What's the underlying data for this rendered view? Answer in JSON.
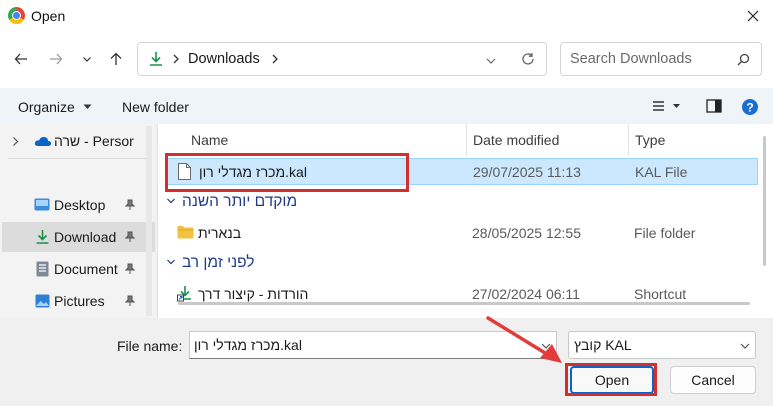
{
  "window": {
    "title": "Open",
    "close_icon": "close-icon",
    "app_icon": "chrome-icon"
  },
  "nav": {
    "back_icon": "back-arrow-icon",
    "forward_icon": "forward-arrow-icon",
    "recent_icon": "chevron-down-icon",
    "up_icon": "up-arrow-icon",
    "breadcrumb": "Downloads",
    "search_placeholder": "Search Downloads"
  },
  "toolbar": {
    "organize": "Organize",
    "new_folder": "New folder"
  },
  "sidebar": {
    "items": [
      {
        "label": "שרה - Persor",
        "icon": "onedrive-icon"
      },
      {
        "label": "Desktop",
        "icon": "desktop-icon"
      },
      {
        "label": "Download",
        "icon": "download-icon"
      },
      {
        "label": "Document",
        "icon": "document-icon"
      },
      {
        "label": "Pictures",
        "icon": "pictures-icon"
      }
    ]
  },
  "columns": {
    "name": "Name",
    "date": "Date modified",
    "type": "Type"
  },
  "groups": {
    "g1": "מוקדם יותר השנה",
    "g2": "לפני זמן רב"
  },
  "files": [
    {
      "name": "מכרז מגדלי רון.kal",
      "date": "29/07/2025 11:13",
      "type": "KAL File",
      "selected": true
    },
    {
      "name": "בנארית",
      "date": "28/05/2025 12:55",
      "type": "File folder"
    },
    {
      "name": "הורדות - קיצור דרך",
      "date": "27/02/2024 06:11",
      "type": "Shortcut"
    }
  ],
  "footer": {
    "file_name_label": "File name:",
    "file_name_value": "מכרז מגדלי רון.kal",
    "file_type_value": "קובץ KAL",
    "open": "Open",
    "cancel": "Cancel"
  },
  "colors": {
    "accent": "#0a64c8",
    "selection": "#cce8ff",
    "annotation": "#d32f2f"
  }
}
